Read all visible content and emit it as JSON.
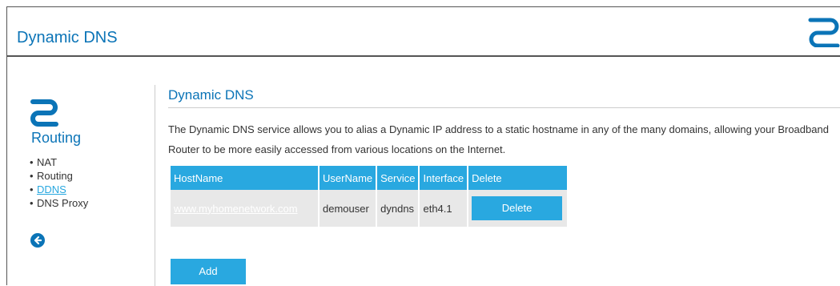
{
  "header": {
    "title": "Dynamic DNS"
  },
  "sidebar": {
    "heading": "Routing",
    "items": [
      {
        "label": "NAT",
        "active": false
      },
      {
        "label": "Routing",
        "active": false
      },
      {
        "label": "DDNS",
        "active": true
      },
      {
        "label": "DNS Proxy",
        "active": false
      }
    ],
    "back_icon": "arrow-left-circle-icon"
  },
  "main": {
    "title": "Dynamic DNS",
    "description": "The Dynamic DNS service allows you to alias a Dynamic IP address to a static hostname in any of the many domains, allowing your Broadband Router to be more easily accessed from various locations on the Internet.",
    "table": {
      "columns": [
        "HostName",
        "UserName",
        "Service",
        "Interface",
        "Delete"
      ],
      "rows": [
        {
          "hostname": "www.myhomenetwork.com",
          "username": "demouser",
          "service": "dyndns",
          "interface": "eth4.1",
          "delete_label": "Delete"
        }
      ]
    },
    "add_label": "Add"
  },
  "colors": {
    "brand": "#0b74b7",
    "accent": "#29a8e0",
    "row_bg": "#e8e8e8"
  }
}
